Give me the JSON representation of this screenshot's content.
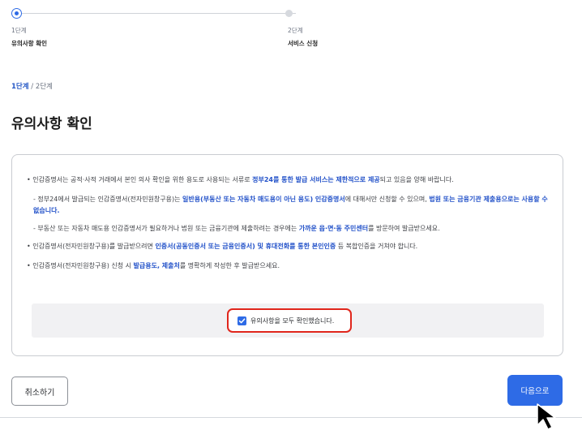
{
  "stepper": {
    "steps": [
      {
        "num": "1단계",
        "name": "유의사항 확인"
      },
      {
        "num": "2단계",
        "name": "서비스 신청"
      }
    ]
  },
  "progress": {
    "current": "1단계",
    "rest": " / 2단계"
  },
  "page_title": "유의사항 확인",
  "notice": {
    "item1": {
      "t1": "인감증명서는 공적·사적 거래에서 본인 의사 확인을 위한 용도로 사용되는 서류로 ",
      "b1": "정부24를 통한 발급 서비스는 제한적으로 제공",
      "t2": "되고 있음을 양해 바랍니다."
    },
    "sub1": {
      "t1": "- 정부24에서 발급되는 인감증명서(전자민원창구용)는 ",
      "b1": "일반용(부동산 또는 자동차 매도용이 아닌 용도) 인감증명서",
      "t2": "에 대해서만 신청할 수 있으며, ",
      "b2": "법원 또는 금융기관 제출용으로는 사용할 수 없습니다."
    },
    "sub2": {
      "t1": "- 부동산 또는 자동차 매도용 인감증명서가 필요하거나 법원 또는 금융기관에 제출하려는 경우에는 ",
      "b1": "가까운 읍·면·동 주민센터",
      "t2": "를 방문하여 발급받으세요."
    },
    "item2": {
      "t1": "인감증명서(전자민원창구용)를 발급받으려면 ",
      "b1": "인증서(공동인증서 또는 금융인증서) 및 휴대전화를 통한 본인인증",
      "t2": " 등 복합인증을 거쳐야 합니다."
    },
    "item3": {
      "t1": "인감증명서(전자민원창구용) 신청 시 ",
      "b1": "발급용도, 제출처",
      "t2": "를 명확하게 작성한 후 발급받으세요."
    }
  },
  "confirm": {
    "label": "유의사항을 모두 확인했습니다.",
    "checked": true,
    "highlight_color": "#e0261c"
  },
  "buttons": {
    "cancel": "취소하기",
    "next": "다음으로"
  },
  "colors": {
    "accent": "#2e6be6",
    "emphasis": "#2352c9"
  },
  "icons": {
    "checkbox": "check-icon",
    "cursor": "mouse-pointer-icon"
  }
}
